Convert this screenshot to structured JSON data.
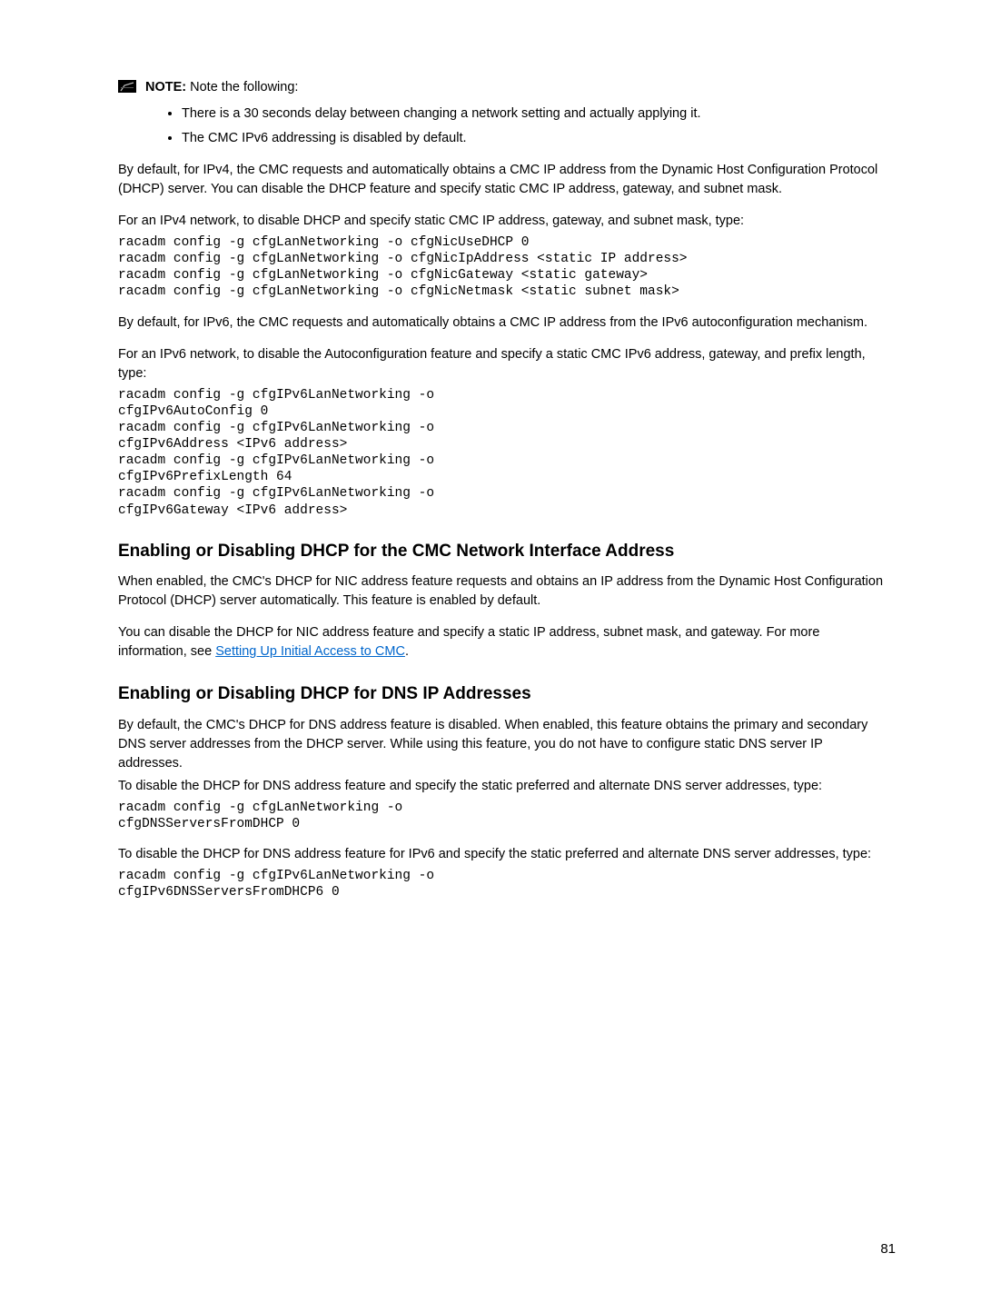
{
  "note": {
    "label": "NOTE:",
    "text": " Note the following:",
    "bullets": [
      "There is a 30 seconds delay between changing a network setting and actually applying it.",
      "The CMC IPv6 addressing is disabled by default."
    ]
  },
  "para1": "By default, for IPv4, the CMC requests and automatically obtains a CMC IP address from the Dynamic Host Configuration Protocol (DHCP) server. You can disable the DHCP feature and specify static CMC IP address, gateway, and subnet mask.",
  "para2": "For an IPv4 network, to disable DHCP and specify static CMC IP address, gateway, and subnet mask, type:",
  "code1": "racadm config -g cfgLanNetworking -o cfgNicUseDHCP 0\nracadm config -g cfgLanNetworking -o cfgNicIpAddress <static IP address>\nracadm config -g cfgLanNetworking -o cfgNicGateway <static gateway>\nracadm config -g cfgLanNetworking -o cfgNicNetmask <static subnet mask>",
  "para3": "By default, for IPv6, the CMC requests and automatically obtains a CMC IP address from the IPv6 autoconfiguration mechanism.",
  "para4": "For an IPv6 network, to disable the Autoconfiguration feature and specify a static CMC IPv6 address, gateway, and prefix length, type:",
  "code2": "racadm config -g cfgIPv6LanNetworking -o\ncfgIPv6AutoConfig 0\nracadm config -g cfgIPv6LanNetworking -o\ncfgIPv6Address <IPv6 address>\nracadm config -g cfgIPv6LanNetworking -o\ncfgIPv6PrefixLength 64\nracadm config -g cfgIPv6LanNetworking -o\ncfgIPv6Gateway <IPv6 address>",
  "sec1": {
    "heading": "Enabling or Disabling DHCP for the CMC Network Interface Address",
    "p1": "When enabled, the CMC's DHCP for NIC address feature requests and obtains an IP address from the Dynamic Host Configuration Protocol (DHCP) server automatically. This feature is enabled by default.",
    "p2a": "You can disable the DHCP for NIC address feature and specify a static IP address, subnet mask, and gateway. For more information, see ",
    "link": "Setting Up Initial Access to CMC",
    "p2b": "."
  },
  "sec2": {
    "heading": "Enabling or Disabling DHCP for DNS IP Addresses",
    "p1": "By default, the CMC's DHCP for DNS address feature is disabled. When enabled, this feature obtains the primary and secondary DNS server addresses from the DHCP server. While using this feature, you do not have to configure static DNS server IP addresses.",
    "p2": "To disable the DHCP for DNS address feature and specify the static preferred and alternate DNS server addresses, type:",
    "code1": "racadm config -g cfgLanNetworking -o\ncfgDNSServersFromDHCP 0",
    "p3": "To disable the DHCP for DNS address feature for IPv6 and specify the static preferred and alternate DNS server addresses, type:",
    "code2": "racadm config -g cfgIPv6LanNetworking -o\ncfgIPv6DNSServersFromDHCP6 0"
  },
  "pagenum": "81"
}
